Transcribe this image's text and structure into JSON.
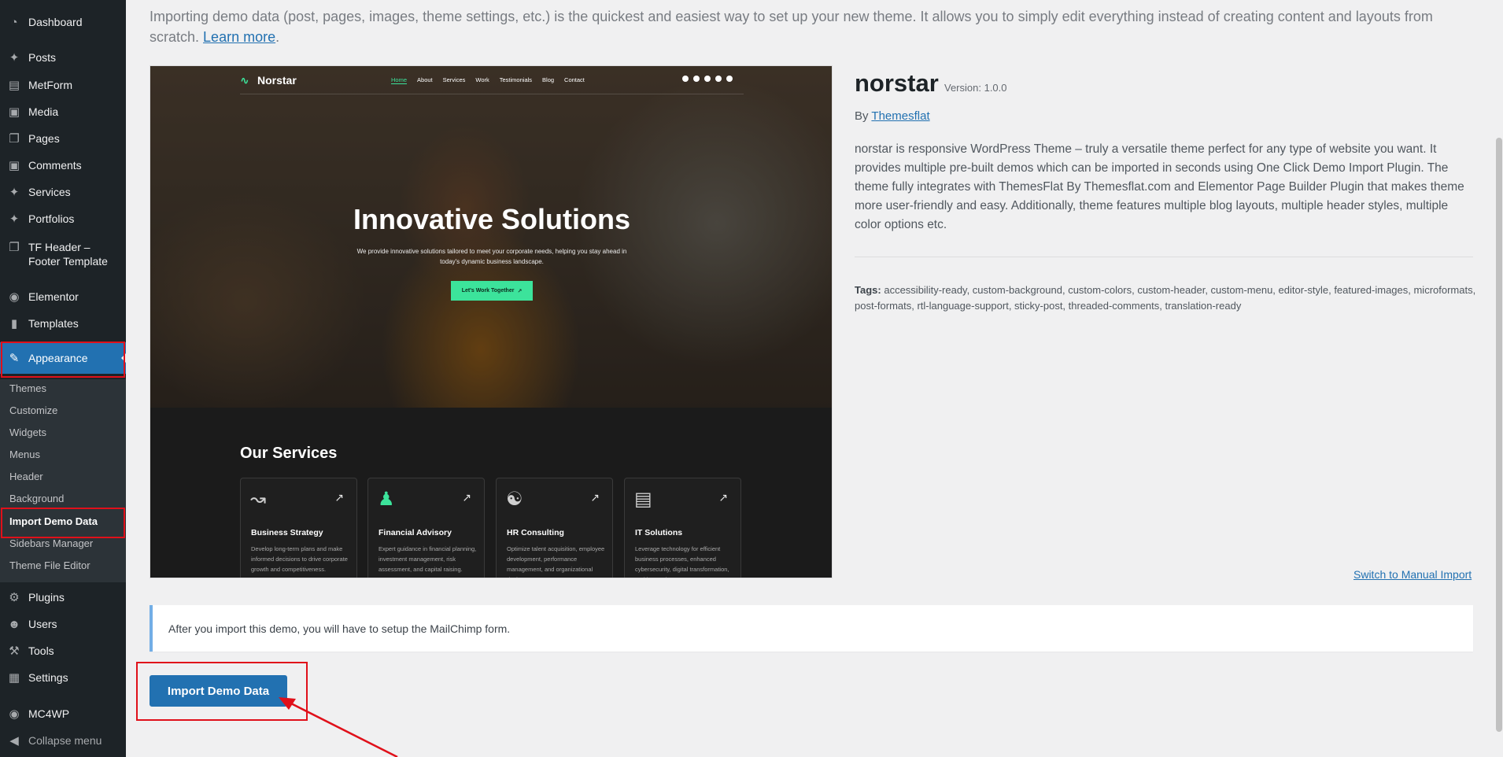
{
  "sidebar": {
    "menu": [
      {
        "label": "Dashboard",
        "icon": "dashboard-icon"
      },
      {
        "label": "Posts",
        "icon": "pin-icon"
      },
      {
        "label": "MetForm",
        "icon": "form-icon"
      },
      {
        "label": "Media",
        "icon": "media-icon"
      },
      {
        "label": "Pages",
        "icon": "pages-icon"
      },
      {
        "label": "Comments",
        "icon": "comments-icon"
      },
      {
        "label": "Services",
        "icon": "pin-icon"
      },
      {
        "label": "Portfolios",
        "icon": "pin-icon"
      },
      {
        "label": "TF Header – Footer Template",
        "icon": "pages-icon"
      },
      {
        "label": "Elementor",
        "icon": "elementor-icon"
      },
      {
        "label": "Templates",
        "icon": "folder-icon"
      },
      {
        "label": "Appearance",
        "icon": "brush-icon"
      },
      {
        "label": "Plugins",
        "icon": "plugin-icon"
      },
      {
        "label": "Users",
        "icon": "user-icon"
      },
      {
        "label": "Tools",
        "icon": "wrench-icon"
      },
      {
        "label": "Settings",
        "icon": "settings-icon"
      },
      {
        "label": "MC4WP",
        "icon": "mc4wp-icon"
      },
      {
        "label": "Collapse menu",
        "icon": "collapse-icon"
      }
    ],
    "submenu": [
      "Themes",
      "Customize",
      "Widgets",
      "Menus",
      "Header",
      "Background",
      "Import Demo Data",
      "Sidebars Manager",
      "Theme File Editor"
    ]
  },
  "intro": {
    "text": "Importing demo data (post, pages, images, theme settings, etc.) is the quickest and easiest way to set up your new theme. It allows you to simply edit everything instead of creating content and layouts from scratch.",
    "link": "Learn more"
  },
  "preview": {
    "logo": "Norstar",
    "nav": [
      "Home",
      "About",
      "Services",
      "Work",
      "Testimonials",
      "Blog",
      "Contact"
    ],
    "headline": "Innovative Solutions",
    "subtext": "We provide innovative solutions tailored to meet your corporate needs, helping you stay ahead in today's dynamic business landscape.",
    "cta": "Let's Work Together",
    "services_title": "Our Services",
    "services": [
      {
        "title": "Business Strategy",
        "desc": "Develop long-term plans and make informed decisions to drive corporate growth and competitiveness."
      },
      {
        "title": "Financial Advisory",
        "desc": "Expert guidance in financial planning, investment management, risk assessment, and capital raising."
      },
      {
        "title": "HR Consulting",
        "desc": "Optimize talent acquisition, employee development, performance management, and organizational design."
      },
      {
        "title": "IT Solutions",
        "desc": "Leverage technology for efficient business processes, enhanced cybersecurity, digital transformation, and innovation."
      }
    ]
  },
  "theme": {
    "name": "norstar",
    "version": "Version: 1.0.0",
    "by_prefix": "By",
    "author": "Themesflat",
    "description": "norstar is responsive WordPress Theme – truly a versatile theme perfect for any type of website you want. It provides multiple pre-built demos which can be imported in seconds using One Click Demo Import Plugin. The theme fully integrates with ThemesFlat By Themesflat.com and Elementor Page Builder Plugin that makes theme more user-friendly and easy. Additionally, theme features multiple blog layouts, multiple header styles, multiple color options etc.",
    "tags_label": "Tags:",
    "tags": "accessibility-ready, custom-background, custom-colors, custom-header, custom-menu, editor-style, featured-images, microformats, post-formats, rtl-language-support, sticky-post, threaded-comments, translation-ready"
  },
  "manual_import_link": "Switch to Manual Import",
  "notice": "After you import this demo, you will have to setup the MailChimp form.",
  "import_button": "Import Demo Data",
  "colors": {
    "sidebar_bg": "#1d2327",
    "accent": "#2271b1",
    "highlight": "#e0101a",
    "preview_accent": "#3ce39b"
  }
}
